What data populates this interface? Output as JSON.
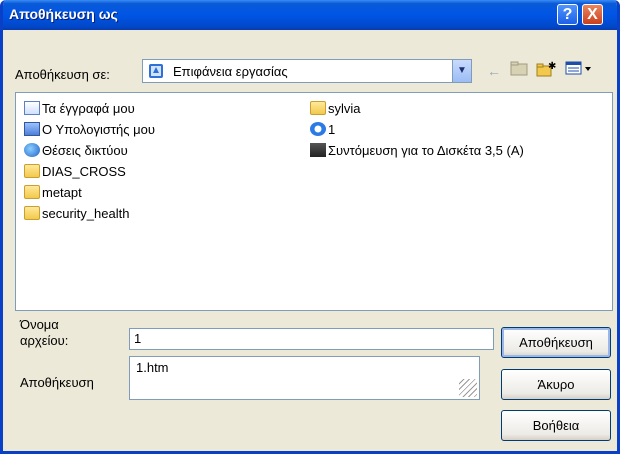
{
  "window": {
    "title": "Αποθήκευση ως",
    "help_label": "?",
    "close_label": "X"
  },
  "save_in": {
    "label": "Αποθήκευση σε:",
    "value": "Επιφάνεια εργασίας"
  },
  "files": [
    {
      "name": "Τα έγγραφά μου",
      "icon": "my-documents-icon"
    },
    {
      "name": "Ο Υπολογιστής μου",
      "icon": "my-computer-icon"
    },
    {
      "name": "Θέσεις δικτύου",
      "icon": "network-places-icon"
    },
    {
      "name": "DIAS_CROSS",
      "icon": "folder-icon"
    },
    {
      "name": "metapt",
      "icon": "folder-icon"
    },
    {
      "name": "security_health",
      "icon": "folder-icon"
    },
    {
      "name": "sylvia",
      "icon": "folder-icon"
    },
    {
      "name": "1",
      "icon": "ie-page-icon"
    },
    {
      "name": "Συντόμευση για το Δισκέτα 3,5 (A)",
      "icon": "floppy-shortcut-icon"
    }
  ],
  "filename": {
    "label": "Όνομα αρχείου:",
    "value": "1"
  },
  "filetype": {
    "label": "Αποθήκευση",
    "value": "1.htm"
  },
  "buttons": {
    "save": "Αποθήκευση",
    "cancel": "Άκυρο",
    "help": "Βοήθεια"
  }
}
